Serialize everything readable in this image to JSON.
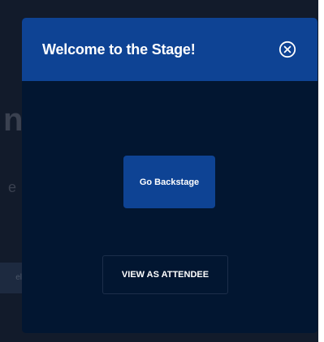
{
  "background": {
    "partial_heading": "n",
    "partial_text": "e",
    "partial_chip": "el"
  },
  "modal": {
    "title": "Welcome to the Stage!",
    "close_icon": "close-circle-icon",
    "primary_button": "Go Backstage",
    "secondary_button": "VIEW AS ATTENDEE"
  },
  "colors": {
    "backdrop": "#121b2b",
    "modal_body": "#021631",
    "header": "#0e4394",
    "primary_button": "#0e4394",
    "text": "#ffffff"
  }
}
